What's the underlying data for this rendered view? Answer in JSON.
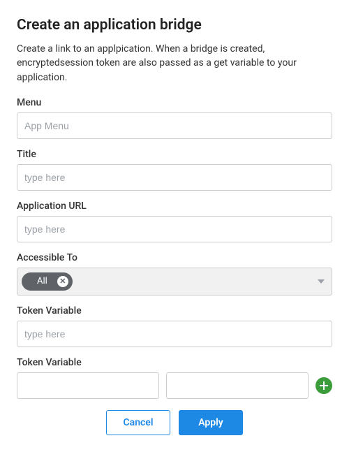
{
  "heading": "Create an application bridge",
  "description": "Create a link to an applpication. When a bridge is created, encryptedsession token are also passed as a get variable to your application.",
  "fields": {
    "menu": {
      "label": "Menu",
      "placeholder": "App Menu",
      "value": ""
    },
    "title": {
      "label": "Title",
      "placeholder": "type here",
      "value": ""
    },
    "appUrl": {
      "label": "Application URL",
      "placeholder": "type here",
      "value": ""
    },
    "accessibleTo": {
      "label": "Accessible To",
      "selectedChip": "All"
    },
    "tokenVariable": {
      "label": "Token Variable",
      "placeholder": "type here",
      "value": ""
    },
    "tokenPair": {
      "label": "Token Variable",
      "keyPlaceholder": "",
      "valuePlaceholder": ""
    }
  },
  "buttons": {
    "cancel": "Cancel",
    "apply": "Apply"
  }
}
